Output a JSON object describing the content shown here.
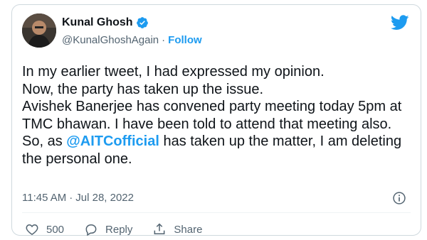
{
  "author": {
    "name": "Kunal Ghosh",
    "handle": "@KunalGhoshAgain",
    "separator": "·",
    "follow_label": "Follow"
  },
  "tweet": {
    "text_before": "In my earlier tweet, I had expressed my opinion.\nNow, the party has taken up the issue.\nAvishek Banerjee has convened party meeting today 5pm at TMC bhawan. I have been told to attend that meeting also.\nSo, as ",
    "mention": "@AITCofficial",
    "text_after": " has taken up the matter, I am deleting the personal one."
  },
  "meta": {
    "time": "11:45 AM",
    "separator": "·",
    "date": "Jul 28, 2022"
  },
  "actions": {
    "like_count": "500",
    "reply_label": "Reply",
    "share_label": "Share"
  },
  "icons": {
    "verified": "verified-badge-icon",
    "twitter": "twitter-bird-icon",
    "info": "info-icon",
    "like": "heart-icon",
    "reply": "reply-bubble-icon",
    "share": "share-upload-icon"
  },
  "colors": {
    "accent": "#1d9bf0",
    "text": "#0f1419",
    "muted": "#536471",
    "border": "#cfd9de"
  }
}
